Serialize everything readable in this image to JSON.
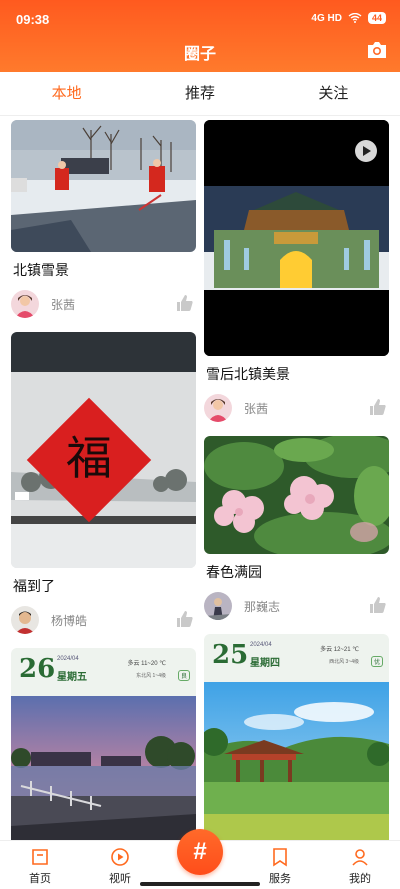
{
  "status_bar": {
    "time": "09:38",
    "network": "4G HD",
    "battery": "44"
  },
  "header": {
    "title": "圈子"
  },
  "tabs": [
    {
      "label": "本地",
      "active": true
    },
    {
      "label": "推荐",
      "active": false
    },
    {
      "label": "关注",
      "active": false
    }
  ],
  "feed": {
    "left": [
      {
        "title": "北镇雪景",
        "author": "张茜"
      },
      {
        "title": "福到了",
        "author": "杨博皓",
        "image_text": "福"
      },
      {
        "calendar": {
          "day": "26",
          "ym": "2024/04",
          "weekday": "星期五",
          "temp": "多云 11~20 ℃",
          "wind": "东北风 1~4级",
          "aq": "良"
        }
      }
    ],
    "right": [
      {
        "title": "雪后北镇美景",
        "author": "张茜",
        "is_video": true
      },
      {
        "title": "春色满园",
        "author": "那巍志"
      },
      {
        "calendar": {
          "day": "25",
          "ym": "2024/04",
          "weekday": "星期四",
          "temp": "多云 12~21 ℃",
          "wind": "西北风 3~4级",
          "aq": "优"
        }
      }
    ]
  },
  "bottom_nav": [
    {
      "label": "首页"
    },
    {
      "label": "视听"
    },
    {
      "label": "#"
    },
    {
      "label": "服务"
    },
    {
      "label": "我的"
    }
  ],
  "colors": {
    "accent": "#ff6a1f",
    "header": "#ff5a1f"
  }
}
